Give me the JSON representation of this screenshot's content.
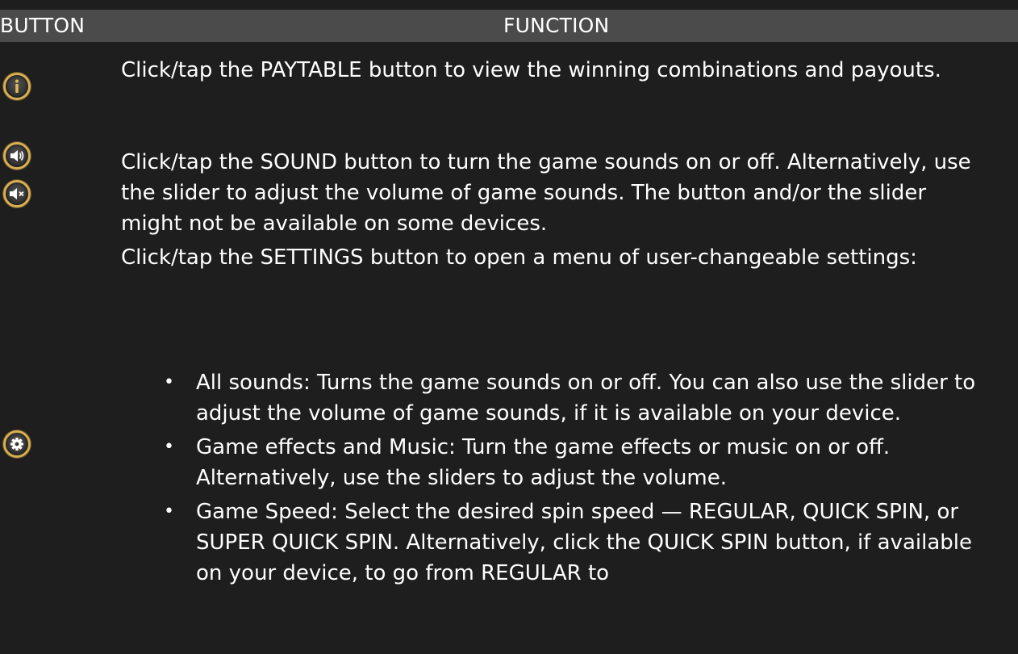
{
  "header": {
    "button_col": "BUTTON",
    "function_col": "FUNCTION"
  },
  "icons": {
    "paytable": "info-icon",
    "sound": "speaker-icon",
    "mute": "speaker-mute-icon",
    "settings": "gear-icon"
  },
  "colors": {
    "background": "#1e1e1e",
    "header_bar": "#4b4b4b",
    "icon_ring": "#d6ae55"
  },
  "rows": {
    "paytable": "Click/tap the PAYTABLE button to view the winning combinations and payouts.",
    "sound": "Click/tap the SOUND button to turn the game sounds on or off. Alternatively, use the slider to adjust the volume of game sounds. The button and/or the slider might not be available on some devices.",
    "settings": "Click/tap the SETTINGS button to open a menu of user-changeable settings:"
  },
  "settings_bullets": [
    "All sounds: Turns the game sounds on or off. You can also use the slider to adjust the volume of game sounds, if it is available on your device.",
    "Game effects and Music: Turn the game effects or music on or off. Alternatively, use the sliders to adjust the volume.",
    "Game Speed: Select the desired spin speed — REGULAR, QUICK SPIN, or SUPER QUICK SPIN. Alternatively, click the QUICK SPIN button, if available on your device, to go from REGULAR to"
  ],
  "bullet_glyph": "•"
}
